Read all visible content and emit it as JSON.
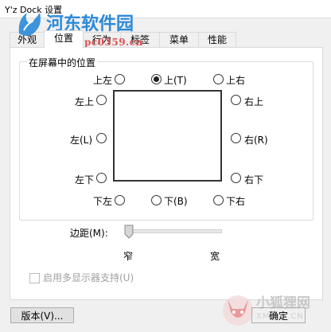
{
  "window": {
    "title": "Y'z Dock 设置"
  },
  "watermark": {
    "site_name": "河东软件园",
    "url": "www.pc0359.cn"
  },
  "tabs": [
    {
      "label": "外观"
    },
    {
      "label": "位置"
    },
    {
      "label": "行为"
    },
    {
      "label": "标签"
    },
    {
      "label": "菜单"
    },
    {
      "label": "性能"
    }
  ],
  "active_tab": "位置",
  "position_group": {
    "title": "在屏幕中的位置",
    "options": {
      "top_left": {
        "label": "上左",
        "checked": false
      },
      "top": {
        "label": "上(T)",
        "checked": true
      },
      "top_right": {
        "label": "上右",
        "checked": false
      },
      "left_top": {
        "label": "左上",
        "checked": false
      },
      "left": {
        "label": "左(L)",
        "checked": false
      },
      "left_bottom": {
        "label": "左下",
        "checked": false
      },
      "right_top": {
        "label": "右上",
        "checked": false
      },
      "right": {
        "label": "右(R)",
        "checked": false
      },
      "right_bottom": {
        "label": "右下",
        "checked": false
      },
      "bottom_left": {
        "label": "下左",
        "checked": false
      },
      "bottom": {
        "label": "下(B)",
        "checked": false
      },
      "bottom_right": {
        "label": "下右",
        "checked": false
      }
    }
  },
  "margin": {
    "label": "边距(M):",
    "min_label": "窄",
    "max_label": "宽",
    "value_fraction": 0
  },
  "multi_monitor": {
    "label": "启用多显示器支持(U)",
    "checked": false,
    "enabled": false
  },
  "buttons": {
    "version": "版本(V)...",
    "ok": "确定"
  },
  "brand_watermark": {
    "cn": "小狐狸网",
    "en": "XMFKS.CN"
  },
  "colors": {
    "watermark_blue": "#2a8ad8",
    "watermark_red": "#e05050"
  }
}
